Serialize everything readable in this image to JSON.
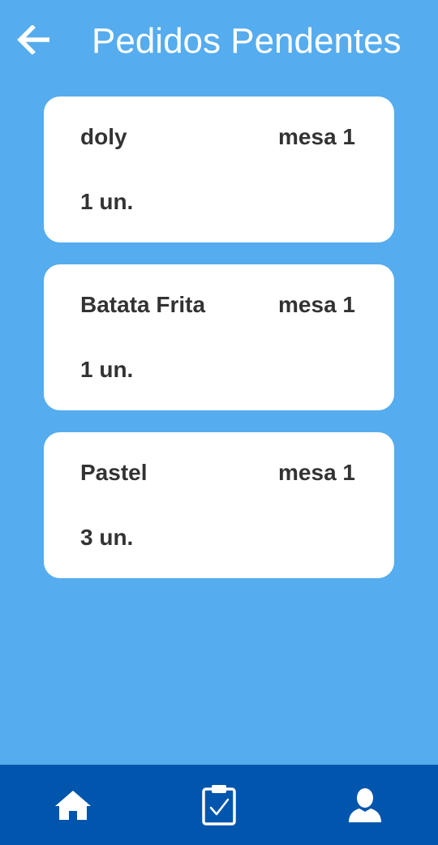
{
  "header": {
    "title": "Pedidos Pendentes",
    "back_icon": "arrow-left-icon"
  },
  "orders": [
    {
      "item": "doly",
      "table": "mesa 1",
      "quantity": "1 un."
    },
    {
      "item": "Batata Frita",
      "table": "mesa 1",
      "quantity": "1 un."
    },
    {
      "item": "Pastel",
      "table": "mesa 1",
      "quantity": "3 un."
    }
  ],
  "bottom_nav": {
    "items": [
      {
        "icon": "home-icon"
      },
      {
        "icon": "clipboard-check-icon"
      },
      {
        "icon": "user-icon"
      }
    ]
  },
  "colors": {
    "background": "#55acee",
    "nav_background": "#0055ad",
    "card": "#ffffff",
    "text": "#333333"
  }
}
